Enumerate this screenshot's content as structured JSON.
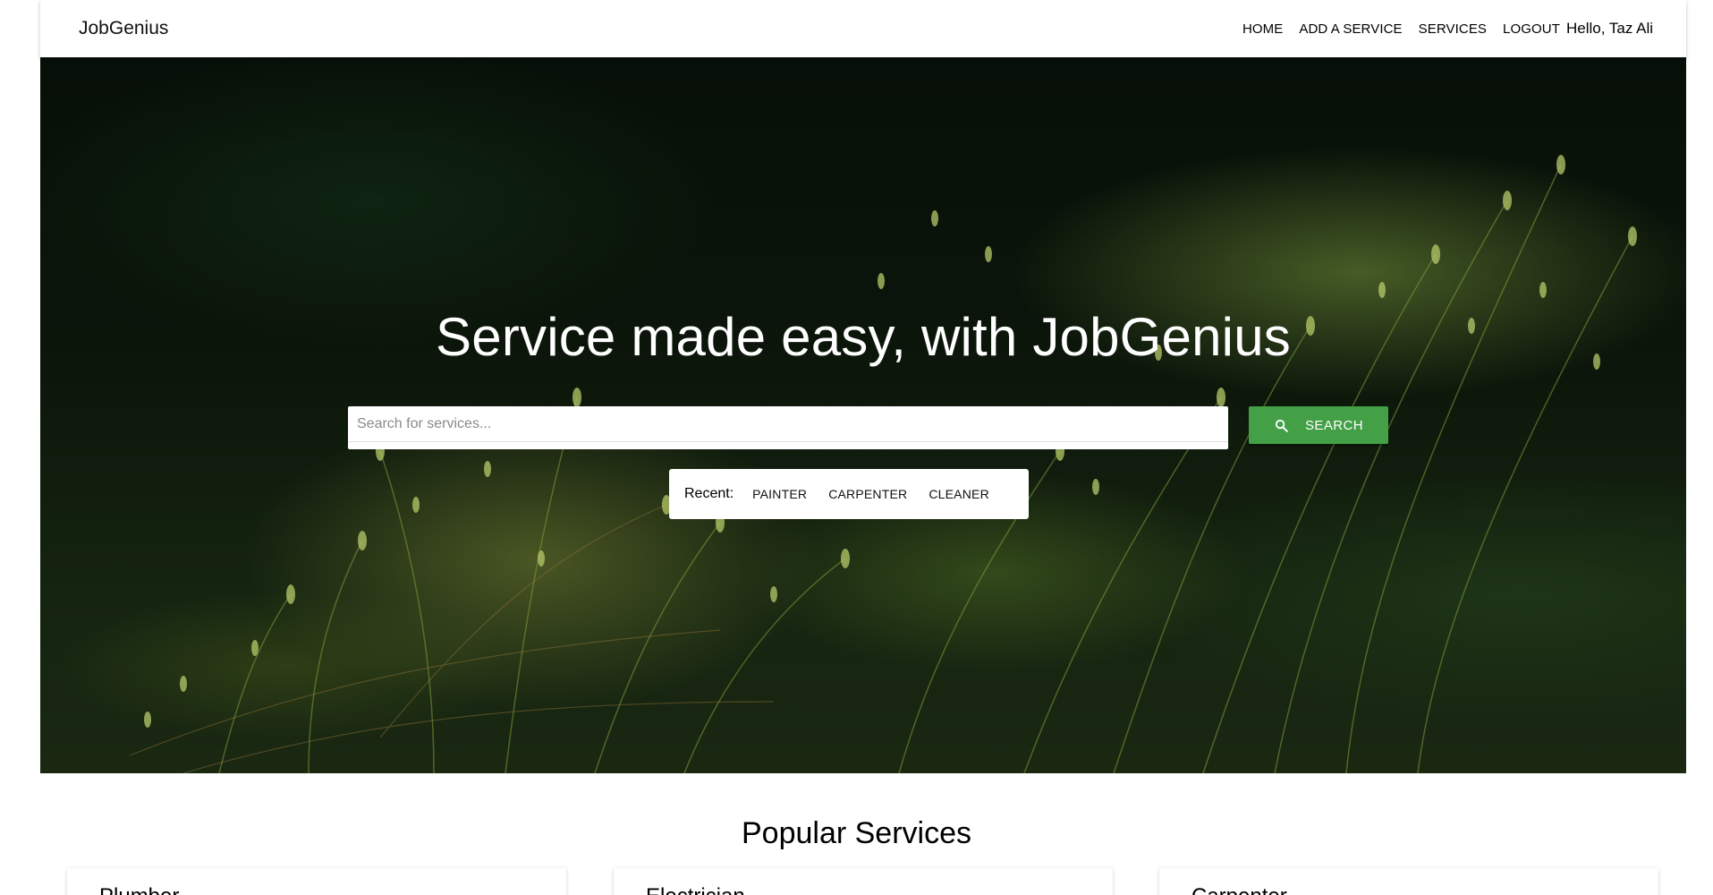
{
  "app": {
    "brand": "JobGenius"
  },
  "nav": {
    "links": [
      "HOME",
      "ADD A SERVICE",
      "SERVICES",
      "LOGOUT"
    ],
    "greeting": "Hello, Taz Ali"
  },
  "hero": {
    "title": "Service made easy, with JobGenius",
    "search": {
      "placeholder": "Search for services...",
      "value": "",
      "button_label": "SEARCH",
      "button_icon": "search-icon"
    },
    "recent": {
      "label": "Recent:",
      "items": [
        "PAINTER",
        "CARPENTER",
        "CLEANER"
      ]
    }
  },
  "popular": {
    "title": "Popular Services",
    "cards": [
      "Plumber",
      "Electrician",
      "Carpenter"
    ]
  },
  "colors": {
    "accent": "#43a047",
    "text": "#000000",
    "background": "#ffffff"
  }
}
